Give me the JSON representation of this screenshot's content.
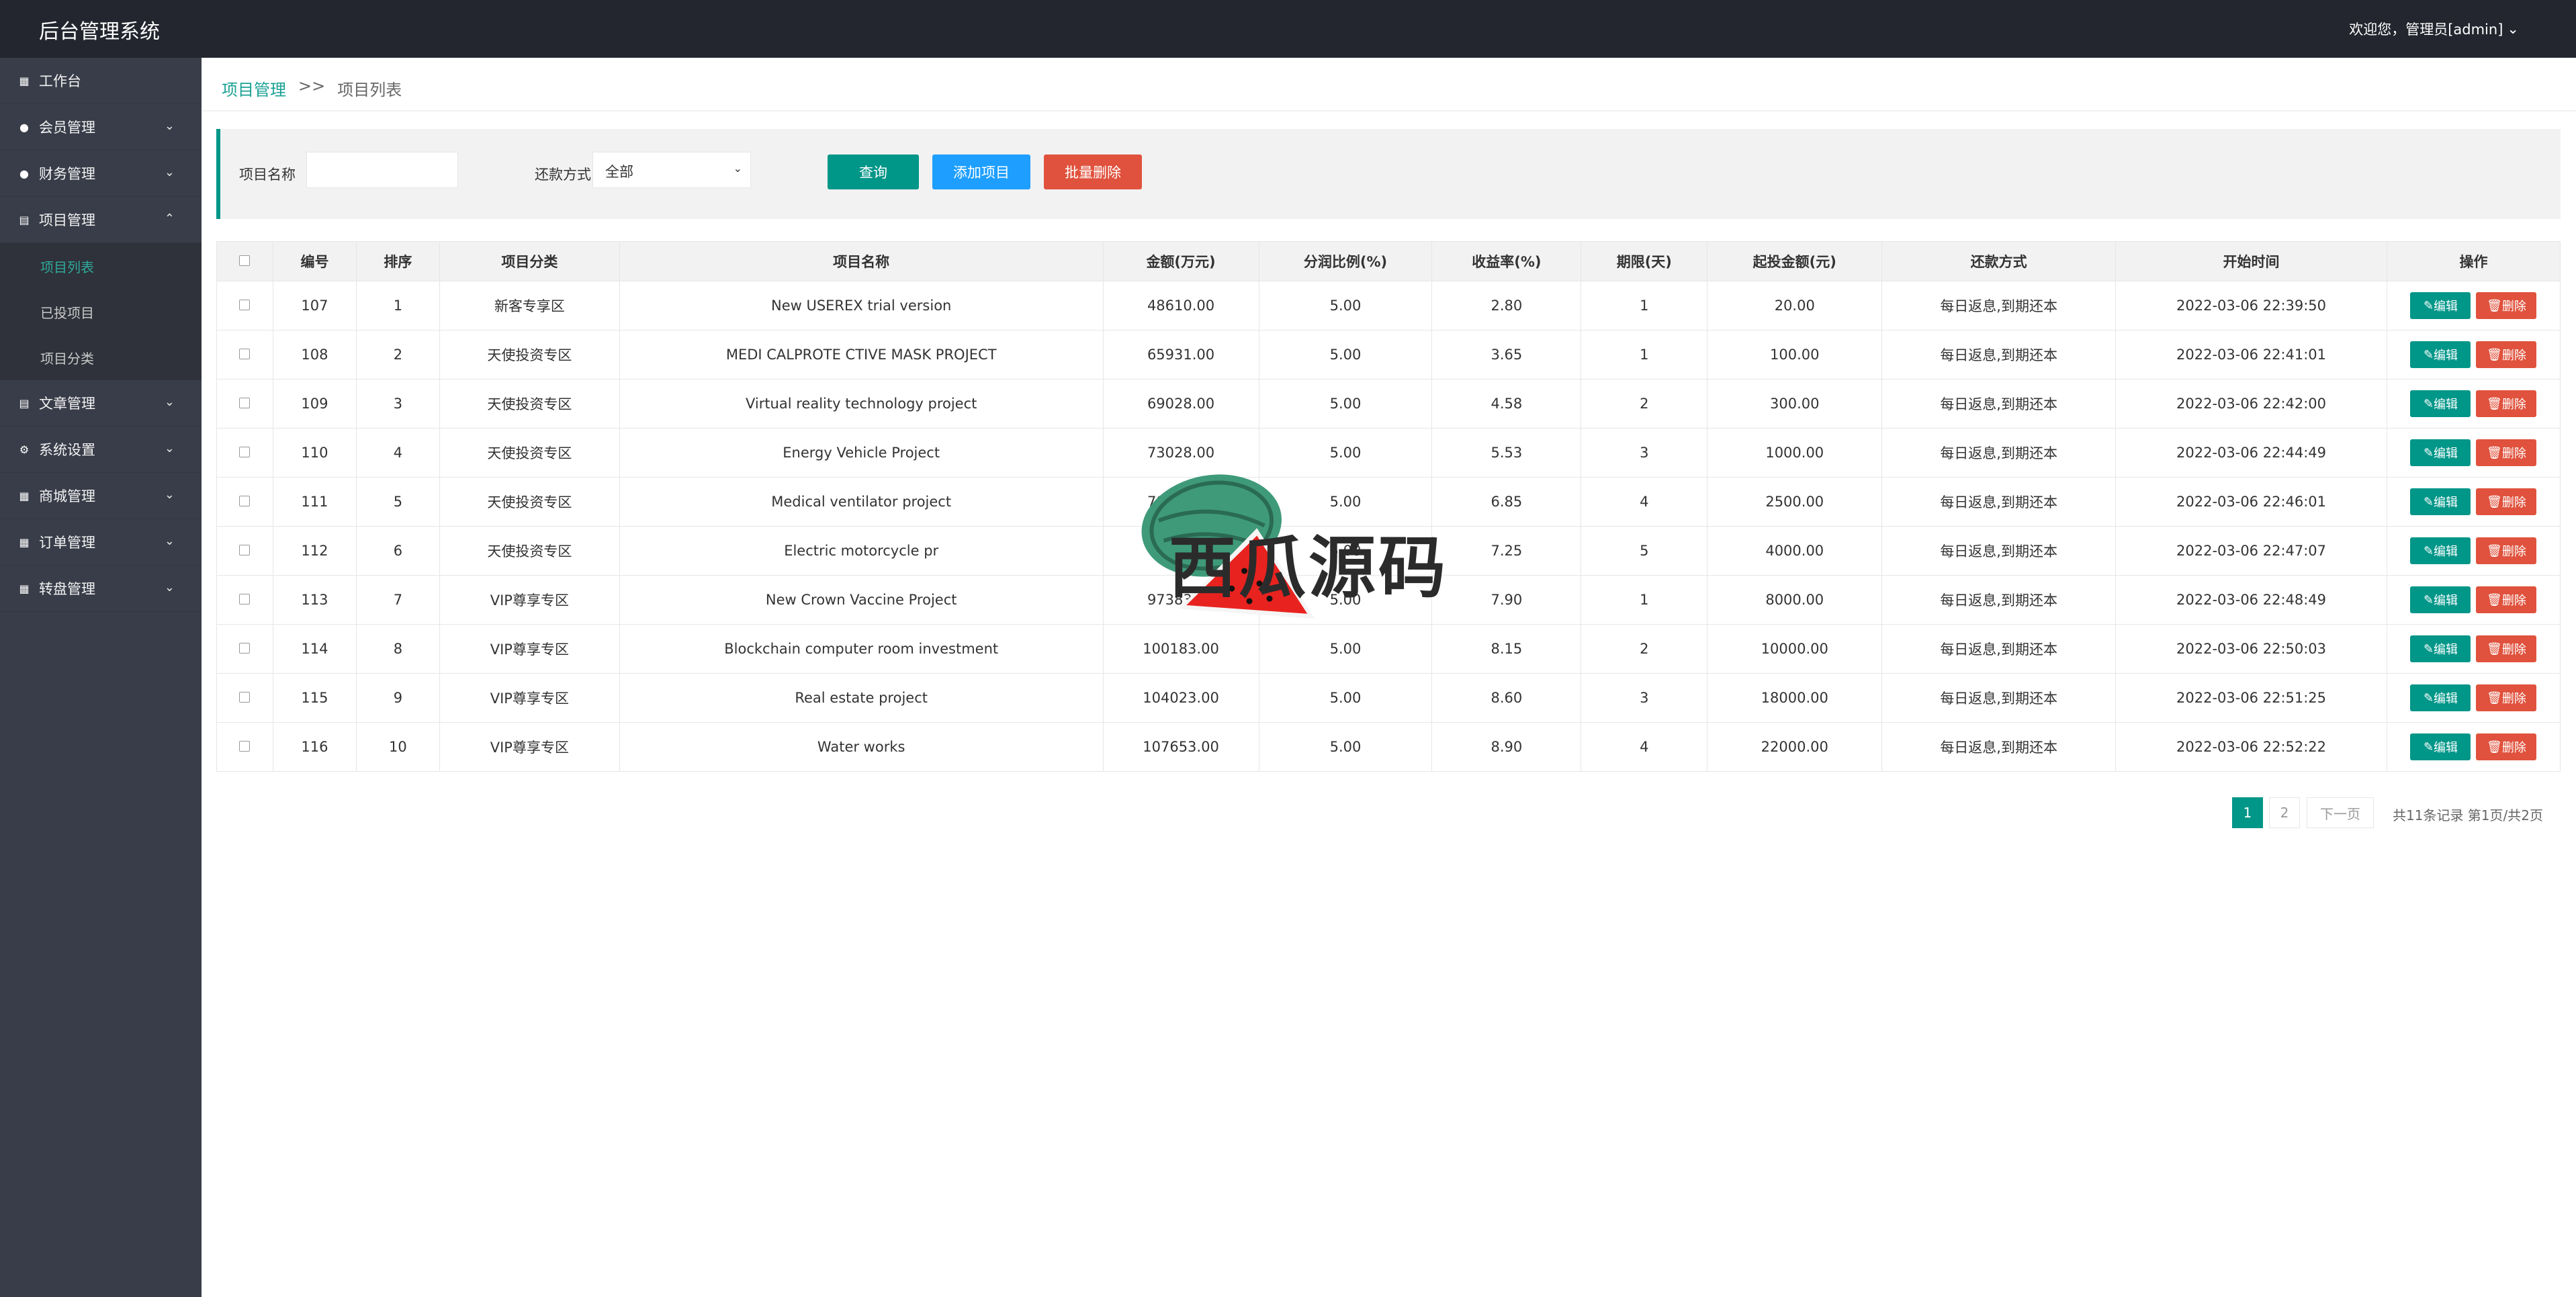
{
  "app": {
    "title": "后台管理系统",
    "user_greeting": "欢迎您，管理员[admin]"
  },
  "sidebar": {
    "items": [
      {
        "label": "工作台",
        "icon": "dashboard-icon",
        "has_children": false
      },
      {
        "label": "会员管理",
        "icon": "member-icon",
        "has_children": true
      },
      {
        "label": "财务管理",
        "icon": "finance-icon",
        "has_children": true
      },
      {
        "label": "项目管理",
        "icon": "project-icon",
        "has_children": true,
        "expanded": true,
        "children": [
          "项目列表",
          "已投项目",
          "项目分类"
        ]
      },
      {
        "label": "文章管理",
        "icon": "article-icon",
        "has_children": true
      },
      {
        "label": "系统设置",
        "icon": "gear-icon",
        "has_children": true
      },
      {
        "label": "商城管理",
        "icon": "shop-icon",
        "has_children": true
      },
      {
        "label": "订单管理",
        "icon": "order-icon",
        "has_children": true
      },
      {
        "label": "转盘管理",
        "icon": "wheel-icon",
        "has_children": true
      }
    ],
    "active_child": "项目列表"
  },
  "breadcrumb": {
    "parent": "项目管理",
    "separator": ">>",
    "current": "项目列表"
  },
  "filter": {
    "name_label": "项目名称",
    "name_value": "",
    "repay_label": "还款方式",
    "repay_value": "全部",
    "query_btn": "查询",
    "add_btn": "添加项目",
    "batch_delete_btn": "批量删除"
  },
  "table": {
    "headers": [
      "编号",
      "排序",
      "项目分类",
      "项目名称",
      "金额(万元)",
      "分润比例(%)",
      "收益率(%)",
      "期限(天)",
      "起投金额(元)",
      "还款方式",
      "开始时间",
      "操作"
    ],
    "edit_label": "编辑",
    "delete_label": "删除",
    "rows": [
      [
        "107",
        "1",
        "新客专享区",
        "New USEREX trial version",
        "48610.00",
        "5.00",
        "2.80",
        "1",
        "20.00",
        "每日返息,到期还本",
        "2022-03-06 22:39:50"
      ],
      [
        "108",
        "2",
        "天使投资专区",
        "MEDI CALPROTE CTIVE MASK PROJECT",
        "65931.00",
        "5.00",
        "3.65",
        "1",
        "100.00",
        "每日返息,到期还本",
        "2022-03-06 22:41:01"
      ],
      [
        "109",
        "3",
        "天使投资专区",
        "Virtual reality technology project",
        "69028.00",
        "5.00",
        "4.58",
        "2",
        "300.00",
        "每日返息,到期还本",
        "2022-03-06 22:42:00"
      ],
      [
        "110",
        "4",
        "天使投资专区",
        "Energy Vehicle Project",
        "73028.00",
        "5.00",
        "5.53",
        "3",
        "1000.00",
        "每日返息,到期还本",
        "2022-03-06 22:44:49"
      ],
      [
        "111",
        "5",
        "天使投资专区",
        "Medical ventilator project",
        "78361.00",
        "5.00",
        "6.85",
        "4",
        "2500.00",
        "每日返息,到期还本",
        "2022-03-06 22:46:01"
      ],
      [
        "112",
        "6",
        "天使投资专区",
        "Electric motorcycle pr",
        "85",
        "5.00",
        "7.25",
        "5",
        "4000.00",
        "每日返息,到期还本",
        "2022-03-06 22:47:07"
      ],
      [
        "113",
        "7",
        "VIP尊享专区",
        "New Crown Vaccine Project",
        "97383.00",
        "5.00",
        "7.90",
        "1",
        "8000.00",
        "每日返息,到期还本",
        "2022-03-06 22:48:49"
      ],
      [
        "114",
        "8",
        "VIP尊享专区",
        "Blockchain computer room investment",
        "100183.00",
        "5.00",
        "8.15",
        "2",
        "10000.00",
        "每日返息,到期还本",
        "2022-03-06 22:50:03"
      ],
      [
        "115",
        "9",
        "VIP尊享专区",
        "Real estate project",
        "104023.00",
        "5.00",
        "8.60",
        "3",
        "18000.00",
        "每日返息,到期还本",
        "2022-03-06 22:51:25"
      ],
      [
        "116",
        "10",
        "VIP尊享专区",
        "Water works",
        "107653.00",
        "5.00",
        "8.90",
        "4",
        "22000.00",
        "每日返息,到期还本",
        "2022-03-06 22:52:22"
      ]
    ]
  },
  "pagination": {
    "pages": [
      "1",
      "2"
    ],
    "current": "1",
    "next_label": "下一页",
    "summary": "共11条记录 第1页/共2页"
  },
  "watermark": {
    "text": "西瓜源码"
  },
  "colors": {
    "primary": "#009688",
    "blue": "#1e9fff",
    "danger": "#e0523d",
    "topbar": "#23262e",
    "sidebar": "#393d49"
  }
}
